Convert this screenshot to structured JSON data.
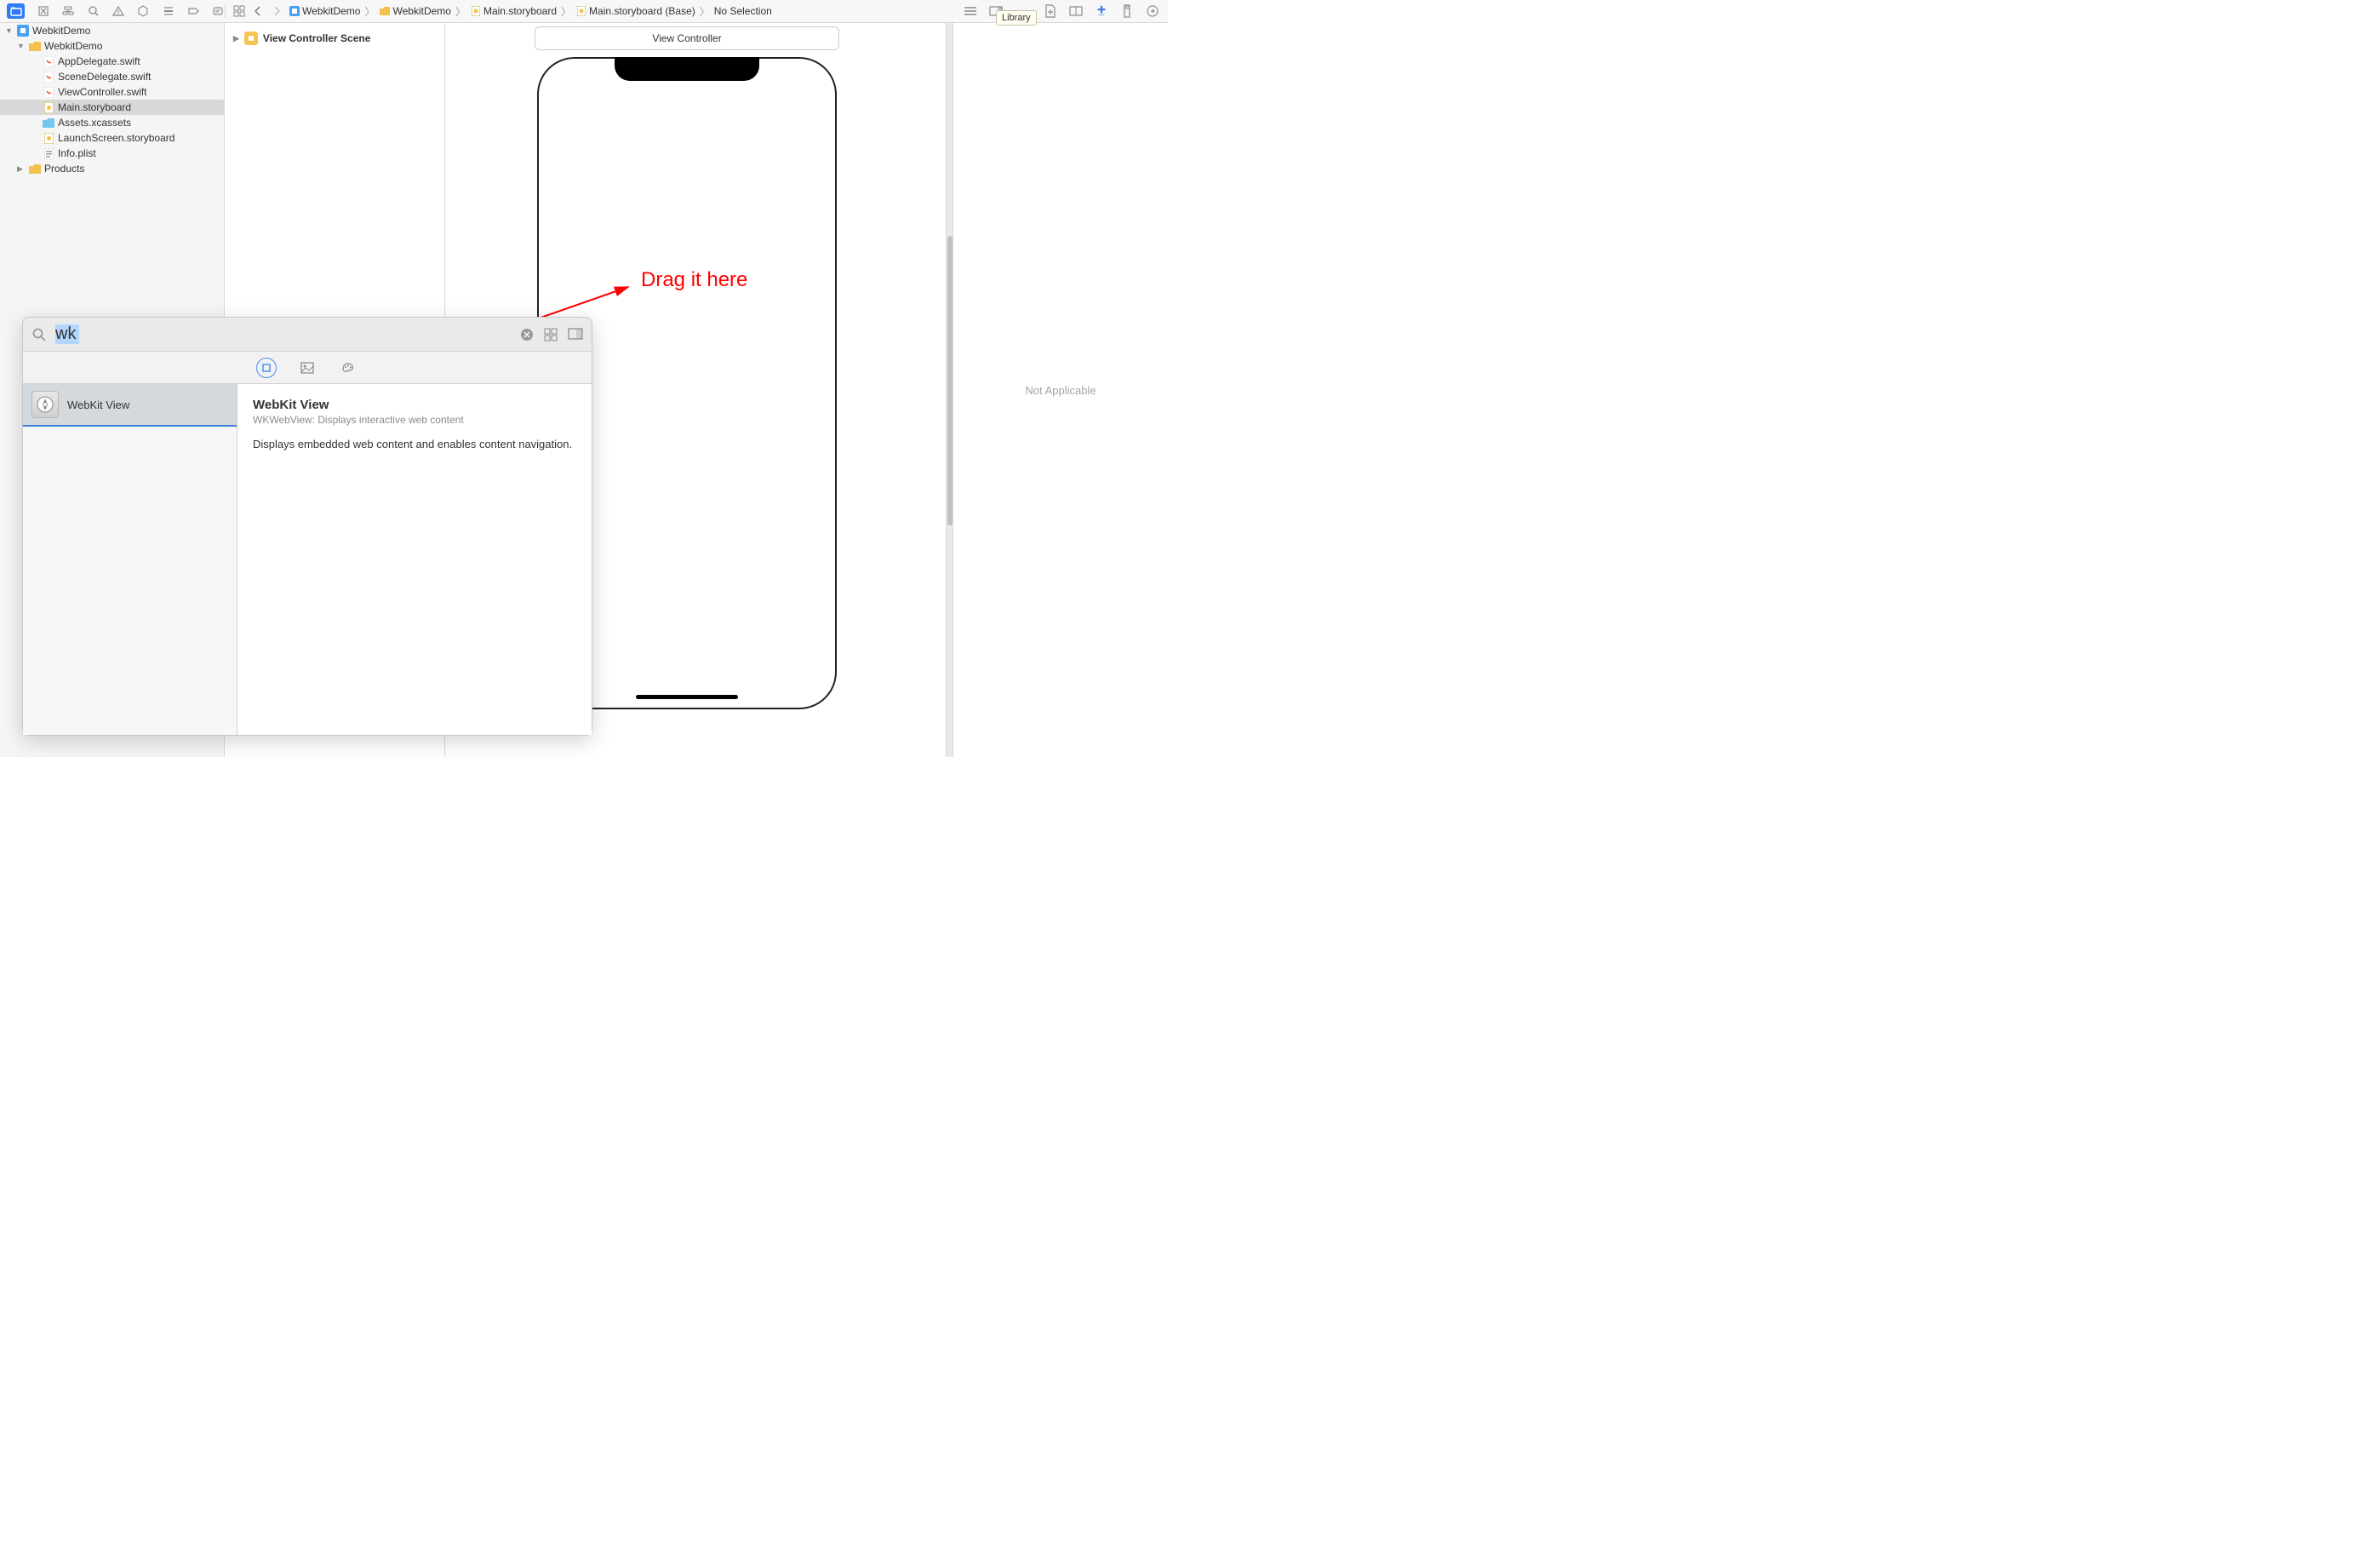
{
  "tooltip": "Library",
  "breadcrumbs": [
    {
      "icon": "project",
      "label": "WebkitDemo"
    },
    {
      "icon": "folder",
      "label": "WebkitDemo"
    },
    {
      "icon": "storyboard",
      "label": "Main.storyboard"
    },
    {
      "icon": "storyboard",
      "label": "Main.storyboard (Base)"
    },
    {
      "icon": "none",
      "label": "No Selection"
    }
  ],
  "navigator": [
    {
      "level": 0,
      "disclose": "down",
      "icon": "project",
      "label": "WebkitDemo"
    },
    {
      "level": 1,
      "disclose": "down",
      "icon": "folder",
      "label": "WebkitDemo"
    },
    {
      "level": 2,
      "disclose": "",
      "icon": "swift",
      "label": "AppDelegate.swift"
    },
    {
      "level": 2,
      "disclose": "",
      "icon": "swift",
      "label": "SceneDelegate.swift"
    },
    {
      "level": 2,
      "disclose": "",
      "icon": "swift",
      "label": "ViewController.swift"
    },
    {
      "level": 2,
      "disclose": "",
      "icon": "storyboard",
      "label": "Main.storyboard",
      "selected": true
    },
    {
      "level": 2,
      "disclose": "",
      "icon": "assets",
      "label": "Assets.xcassets"
    },
    {
      "level": 2,
      "disclose": "",
      "icon": "storyboard",
      "label": "LaunchScreen.storyboard"
    },
    {
      "level": 2,
      "disclose": "",
      "icon": "plist",
      "label": "Info.plist"
    },
    {
      "level": 1,
      "disclose": "right",
      "icon": "folder",
      "label": "Products"
    }
  ],
  "outline": {
    "scene_label": "View Controller Scene"
  },
  "canvas": {
    "title_bar": "View Controller",
    "annotation": "Drag it here"
  },
  "inspector": {
    "body": "Not Applicable"
  },
  "library": {
    "search_value": "wk",
    "result_item": "WebKit View",
    "detail_title": "WebKit View",
    "detail_subtitle": "WKWebView: Displays interactive web content",
    "detail_body": "Displays embedded web content and enables content navigation."
  }
}
